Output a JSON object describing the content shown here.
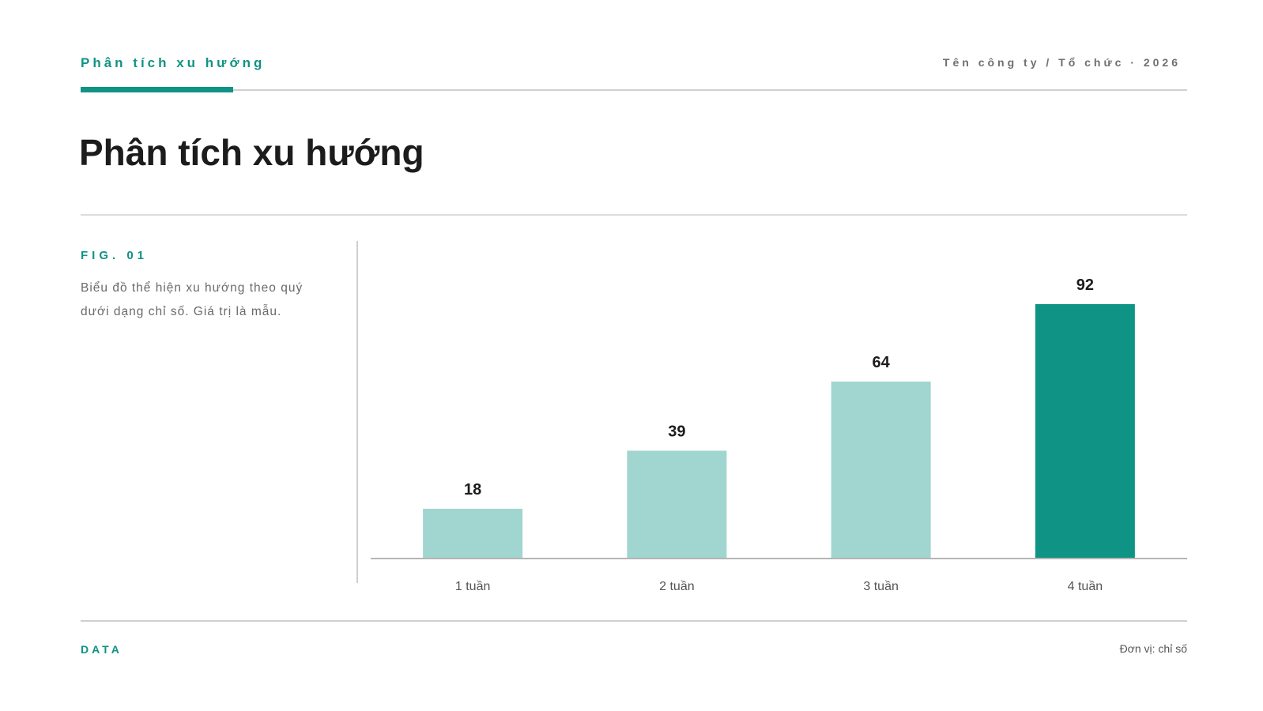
{
  "header": {
    "kicker": "Phân tích xu hướng",
    "organization": "Tên công ty / Tổ chức · 2026"
  },
  "page_title": "Phân tích xu hướng",
  "figure": {
    "label": "FIG. 01",
    "description": "Biểu đồ thể hiện xu hướng theo quý dưới dạng chỉ số. Giá trị là mẫu."
  },
  "footer": {
    "left": "DATA",
    "right": "Đơn vị: chỉ số"
  },
  "colors": {
    "accent": "#0f9384",
    "bar_muted": "#a0d5d0",
    "bar_highlight": "#0f9384"
  },
  "chart_data": {
    "type": "bar",
    "categories": [
      "1 tuần",
      "2 tuần",
      "3 tuần",
      "4 tuần"
    ],
    "values": [
      18,
      39,
      64,
      92
    ],
    "highlight_index": 3,
    "ylim": [
      0,
      100
    ],
    "grid": false,
    "title": "",
    "xlabel": "",
    "ylabel": ""
  }
}
